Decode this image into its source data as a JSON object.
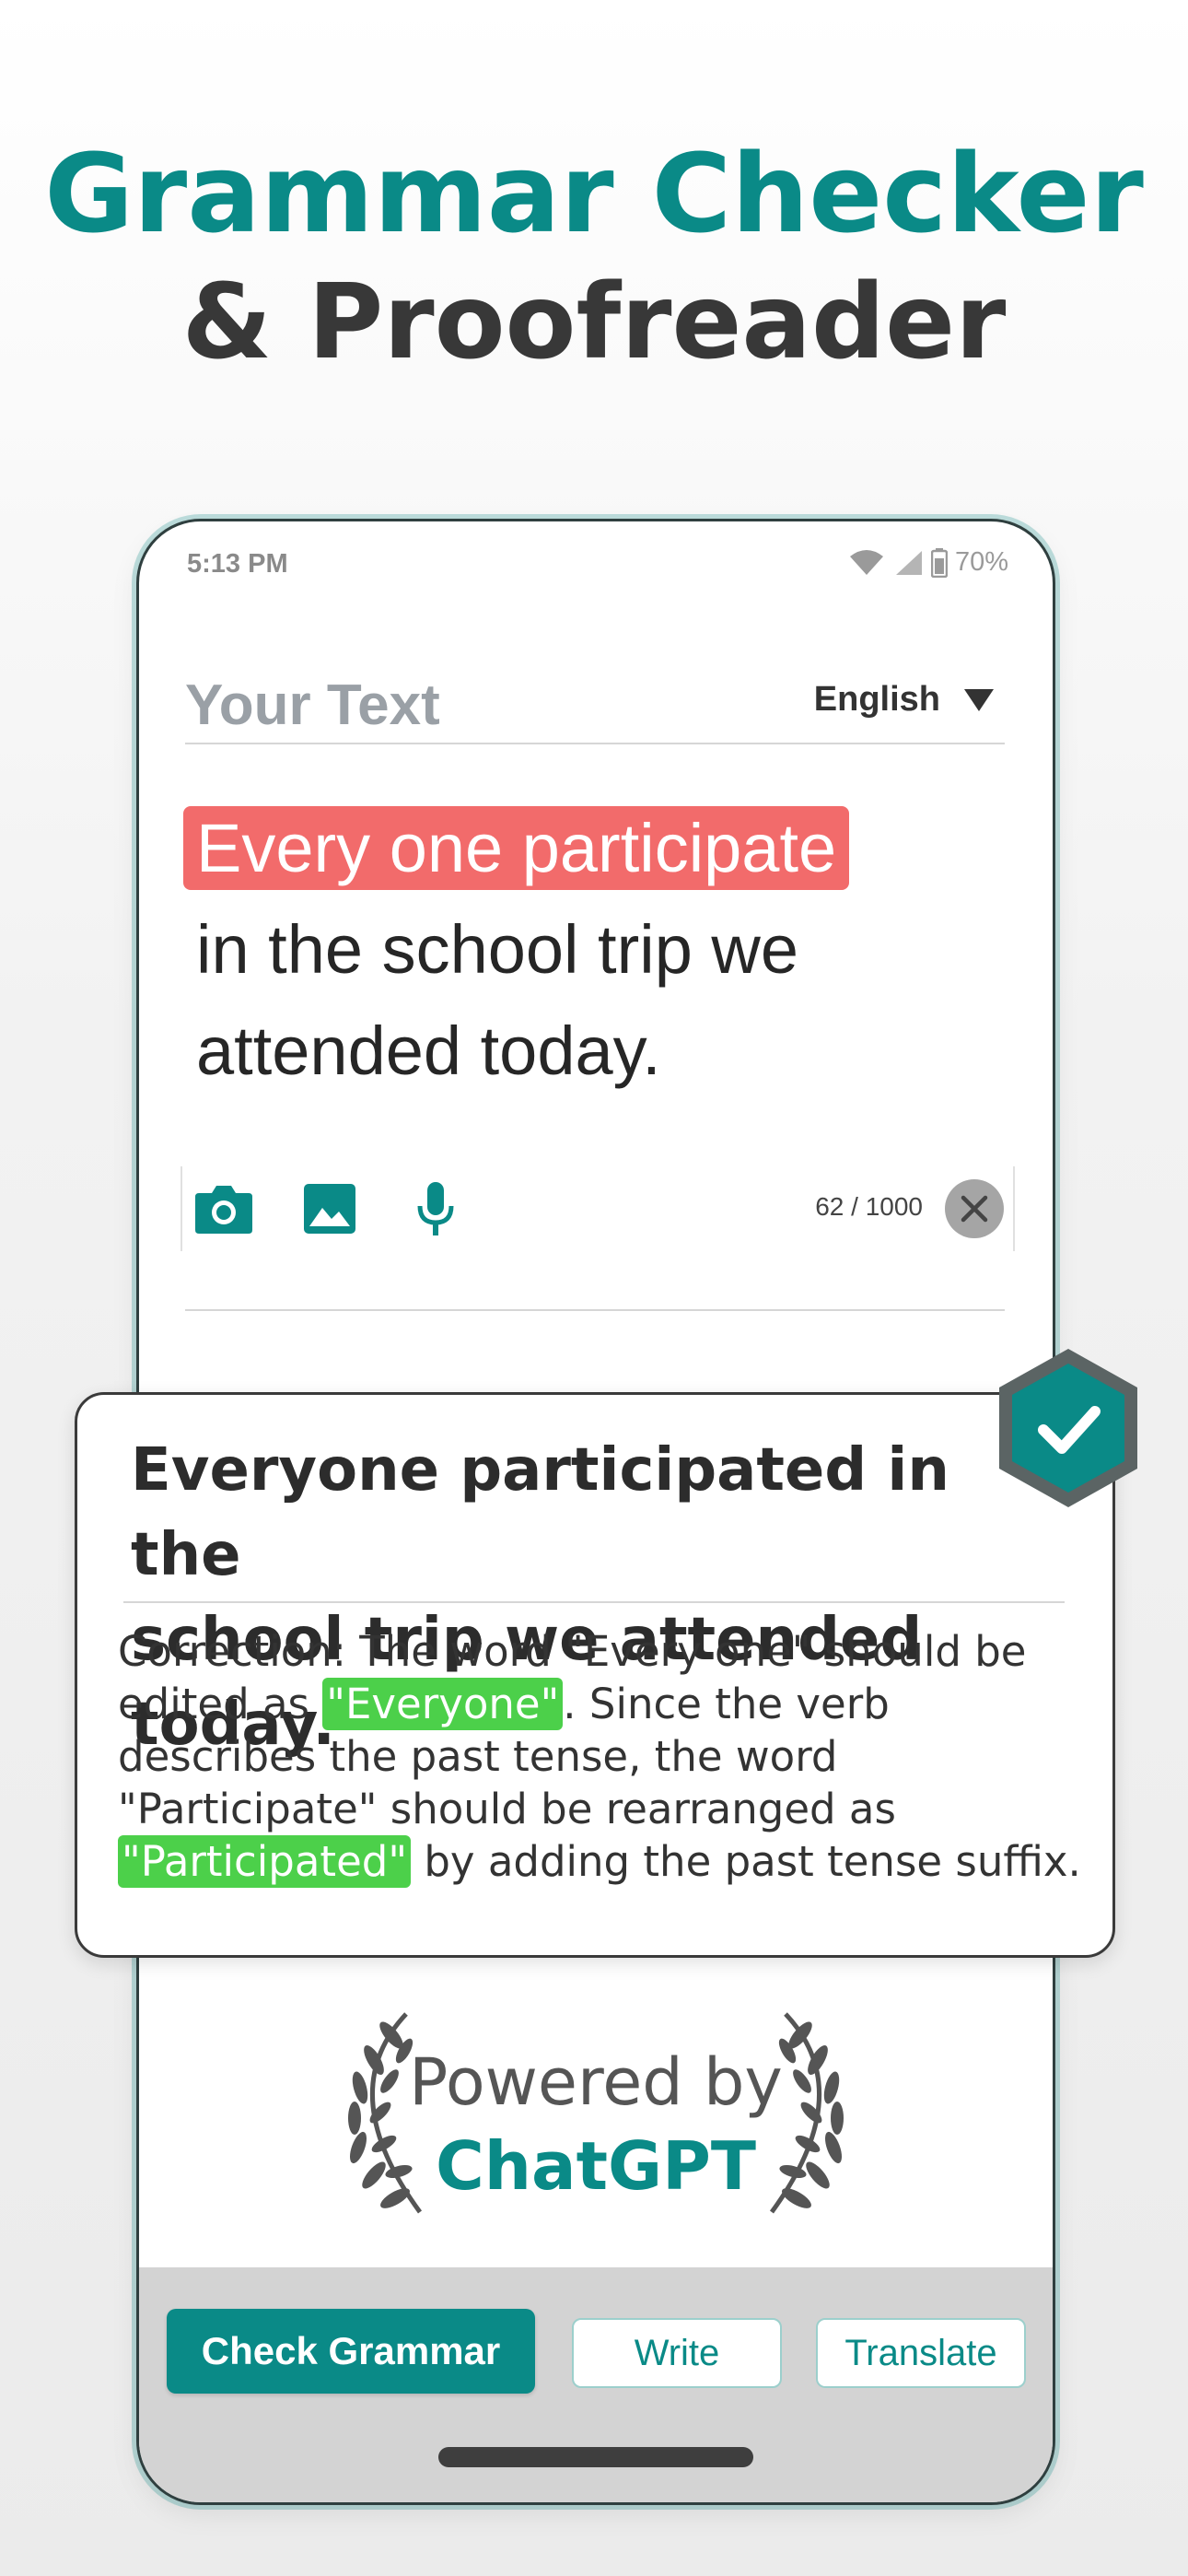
{
  "hero": {
    "title_line1": "Grammar Checker",
    "title_line2": "& Proofreader"
  },
  "status_bar": {
    "time": "5:13 PM",
    "battery": "70%"
  },
  "editor": {
    "label": "Your Text",
    "language": "English",
    "highlighted_error": "Every one participate",
    "text_line2": "in the school trip we",
    "text_line3": "attended today.",
    "char_count": "62 / 1000"
  },
  "result": {
    "corrected_line1": "Everyone participated in the",
    "corrected_line2": "school trip we attended today.",
    "explanation": {
      "part1": "Correction: The word \"Every one\" should be edited as ",
      "hl1": "\"Everyone\"",
      "part2": ". Since the verb describes the past tense, the word \"Participate\" should be rearranged as ",
      "hl2": "\"Participated\"",
      "part3": " by adding the past tense suffix."
    }
  },
  "powered": {
    "line1": "Powered by",
    "brand": "ChatGPT"
  },
  "actions": {
    "primary": "Check Grammar",
    "write": "Write",
    "translate": "Translate"
  },
  "colors": {
    "accent": "#0a8a87",
    "error_highlight": "#f26b6b",
    "success_highlight": "#4cd04a"
  },
  "icons": [
    "camera-icon",
    "image-icon",
    "microphone-icon",
    "close-icon",
    "checkmark-icon",
    "wifi-icon",
    "signal-icon",
    "battery-icon",
    "laurel-icon"
  ]
}
